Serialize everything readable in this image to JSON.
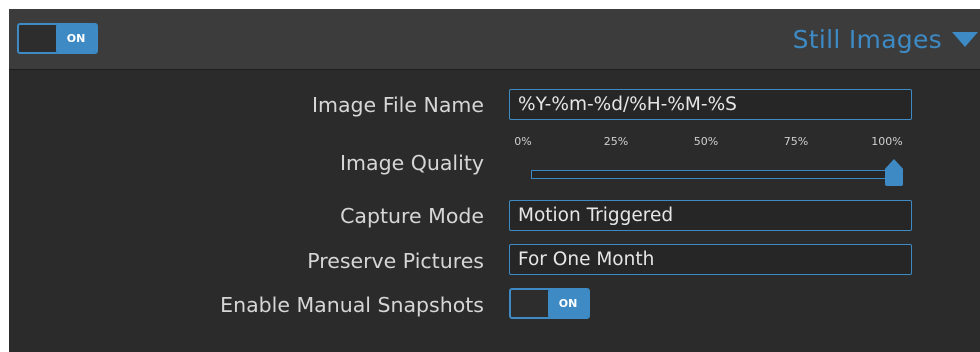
{
  "header": {
    "toggle": {
      "label": "ON",
      "on": true
    },
    "title": "Still Images",
    "caret_icon": "caret-down-icon"
  },
  "form": {
    "image_file_name": {
      "label": "Image File Name",
      "value": "%Y-%m-%d/%H-%M-%S"
    },
    "image_quality": {
      "label": "Image Quality",
      "ticks": [
        "0%",
        "25%",
        "50%",
        "75%",
        "100%"
      ],
      "value_percent": 100
    },
    "capture_mode": {
      "label": "Capture Mode",
      "value": "Motion Triggered"
    },
    "preserve_pictures": {
      "label": "Preserve Pictures",
      "value": "For One Month"
    },
    "enable_manual_snapshots": {
      "label": "Enable Manual Snapshots",
      "toggle_label": "ON",
      "on": true
    }
  },
  "colors": {
    "accent": "#3d8ac4",
    "panel_background": "#2b2b2b",
    "header_background": "#3c3c3c",
    "label_text": "#d6d6d6"
  }
}
